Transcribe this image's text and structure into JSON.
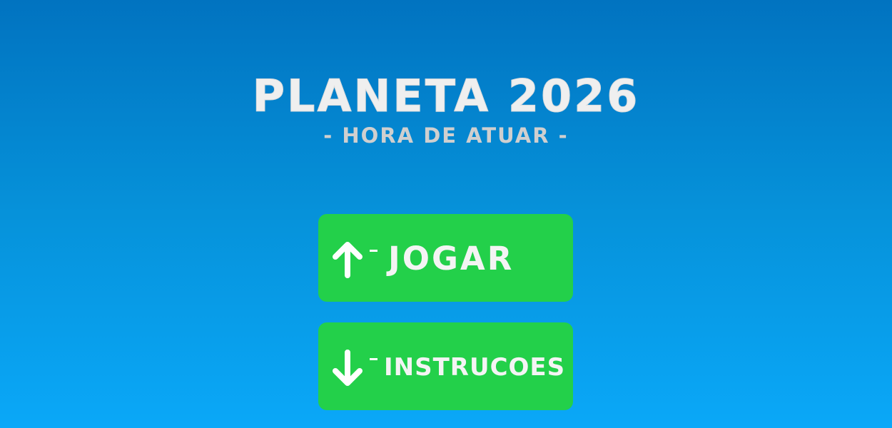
{
  "game": {
    "title": "PLANETA 2026",
    "subtitle": "- HORA DE ATUAR -"
  },
  "menu": {
    "play": {
      "key_icon": "arrow-up-icon",
      "label": "JOGAR"
    },
    "instructions": {
      "key_icon": "arrow-down-icon",
      "label": "INSTRUCOES"
    }
  },
  "colors": {
    "background_top": "#0173c0",
    "background_bottom": "#0aa8f8",
    "button": "#23d04a",
    "text": "#efefef"
  }
}
